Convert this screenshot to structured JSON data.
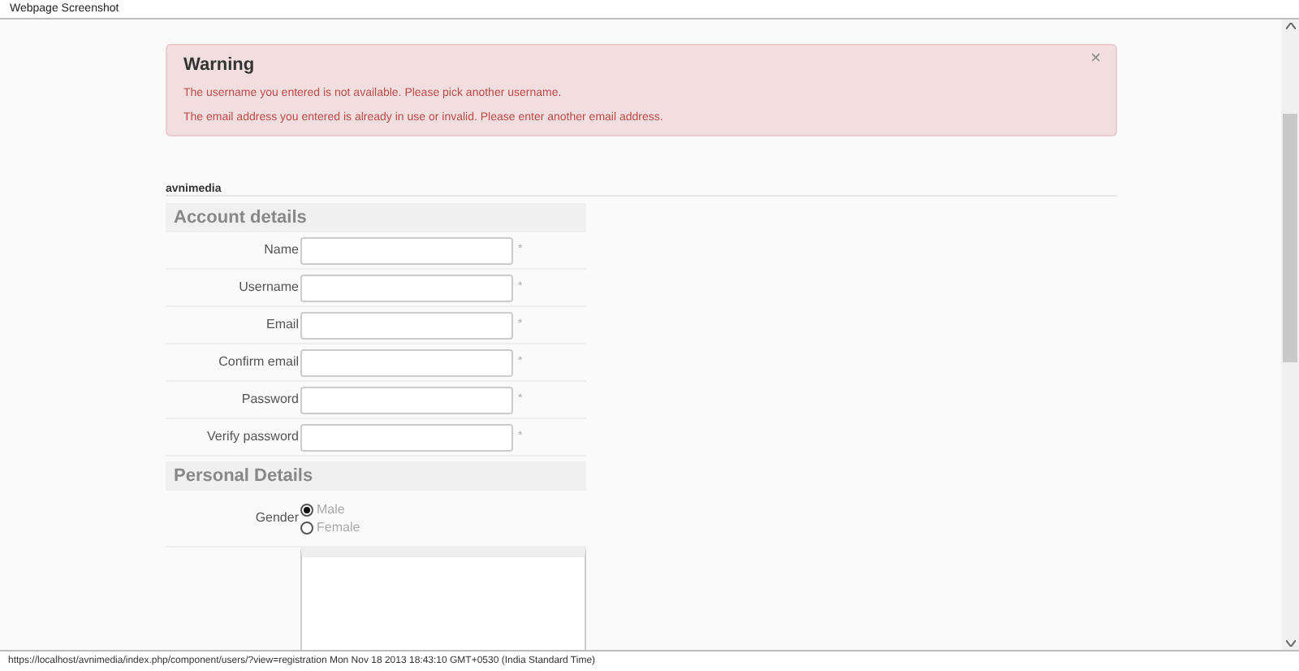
{
  "window": {
    "title": "Webpage Screenshot"
  },
  "alert": {
    "title": "Warning",
    "close": "×",
    "messages": [
      "The username you entered is not available. Please pick another username.",
      "The email address you entered is already in use or invalid. Please enter another email address."
    ]
  },
  "brand": "avnimedia",
  "sections": [
    {
      "heading": "Account details",
      "fields": [
        {
          "label": "Name",
          "required": "*"
        },
        {
          "label": "Username",
          "required": "*"
        },
        {
          "label": "Email",
          "required": "*"
        },
        {
          "label": "Confirm email",
          "required": "*"
        },
        {
          "label": "Password",
          "required": "*"
        },
        {
          "label": "Verify password",
          "required": "*"
        }
      ]
    },
    {
      "heading": "Personal Details",
      "gender": {
        "label": "Gender",
        "options": [
          {
            "label": "Male",
            "selected": true
          },
          {
            "label": "Female",
            "selected": false
          }
        ]
      }
    }
  ],
  "status_bar": "https://localhost/avnimedia/index.php/component/users/?view=registration Mon Nov 18 2013 18:43:10 GMT+0530 (India Standard Time)"
}
